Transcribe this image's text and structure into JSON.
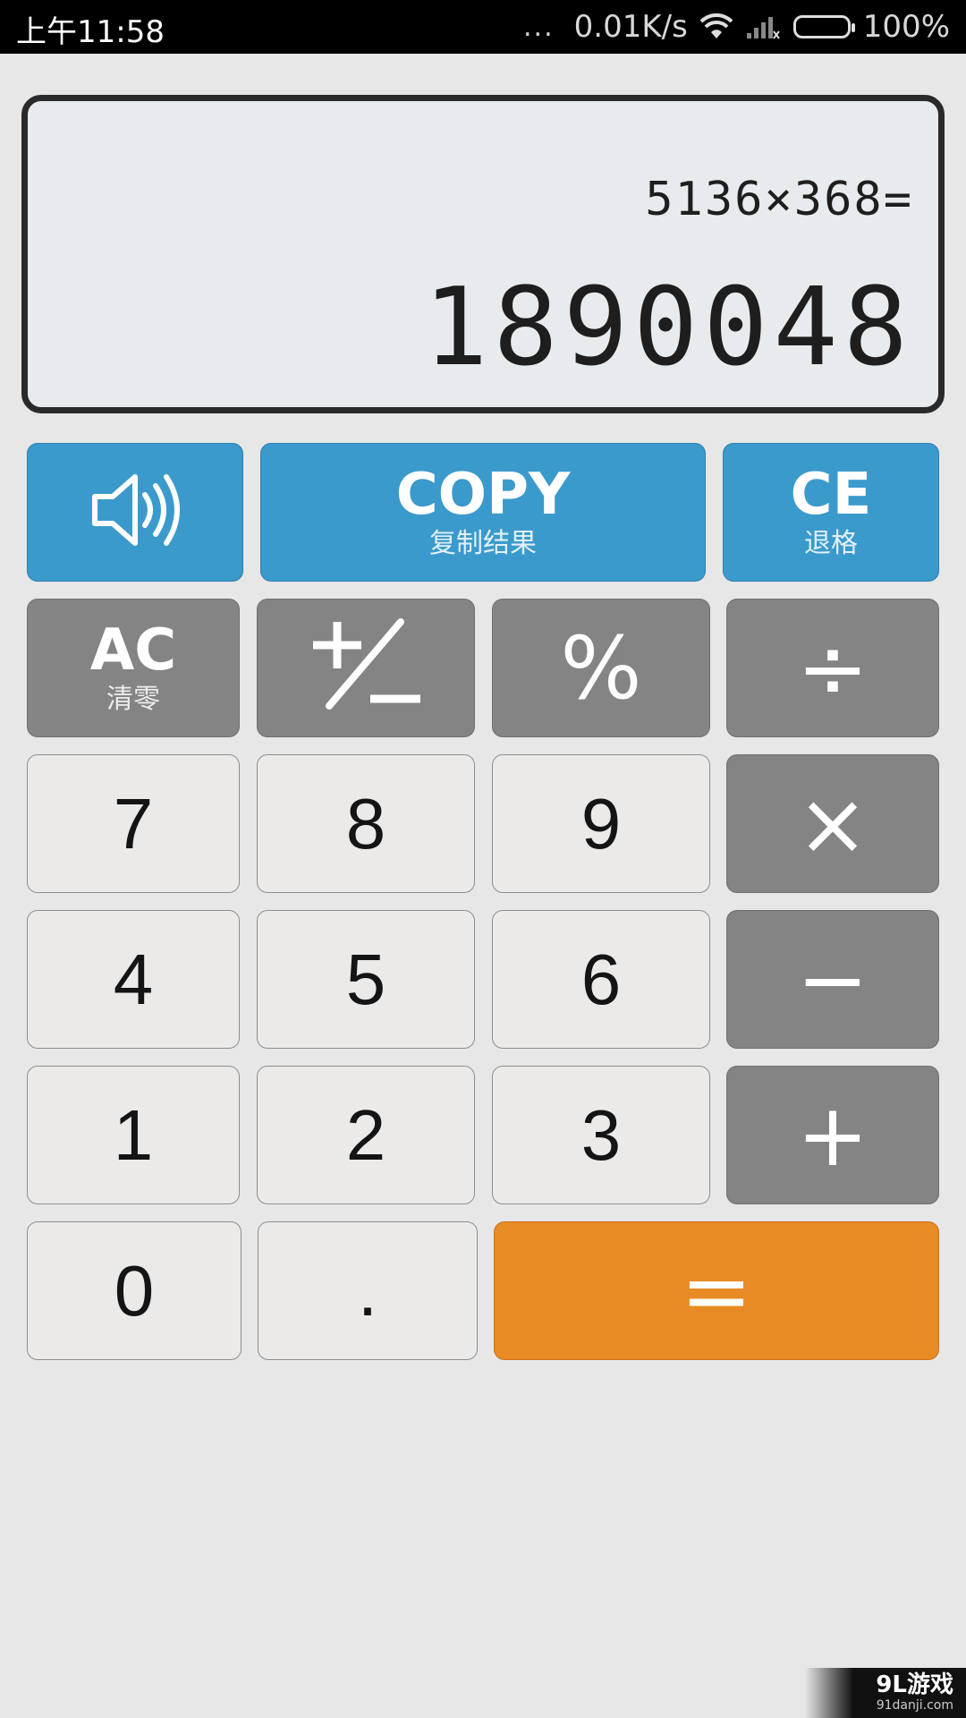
{
  "status_bar": {
    "time": "上午11:58",
    "dots": "...",
    "net_speed": "0.01K/s",
    "battery_percent": "100%",
    "battery_level": 1.0,
    "battery_color": "#6ee012"
  },
  "display": {
    "expression": "5136×368=",
    "result": "1890048"
  },
  "buttons": {
    "sound": {
      "icon": "speaker-icon"
    },
    "copy": {
      "label": "COPY",
      "sub": "复制结果"
    },
    "ce": {
      "label": "CE",
      "sub": "退格"
    },
    "ac": {
      "label": "AC",
      "sub": "清零"
    },
    "plus_minus": {
      "icon": "plus-minus-icon"
    },
    "percent": {
      "label": "%"
    },
    "divide": {
      "label": "÷"
    },
    "multiply": {
      "label": "×"
    },
    "minus": {
      "label": "−"
    },
    "plus": {
      "label": "+"
    },
    "equals": {
      "label": "="
    },
    "dot": {
      "label": "."
    },
    "digits": [
      "0",
      "1",
      "2",
      "3",
      "4",
      "5",
      "6",
      "7",
      "8",
      "9"
    ]
  },
  "colors": {
    "blue": "#3b9acc",
    "gray": "#848484",
    "light": "#ebeae8",
    "orange": "#e88b25"
  },
  "watermark": {
    "main": "9L游戏",
    "sub": "91danji.com"
  }
}
